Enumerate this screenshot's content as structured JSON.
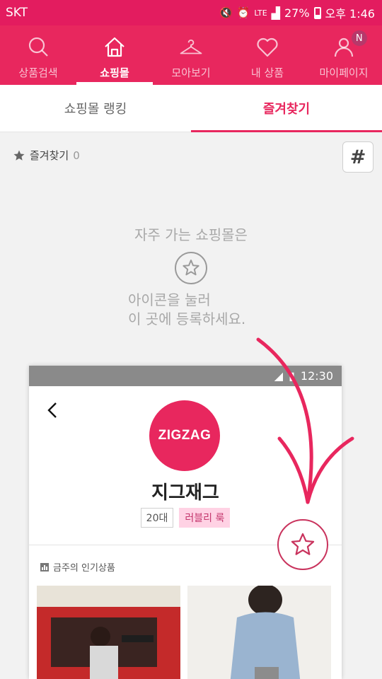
{
  "status_bar": {
    "carrier": "SKT",
    "network": "LTE",
    "battery": "27%",
    "time": "오후 1:46"
  },
  "nav": {
    "items": [
      {
        "label": "상품검색",
        "icon": "search-icon"
      },
      {
        "label": "쇼핑몰",
        "icon": "store-icon"
      },
      {
        "label": "모아보기",
        "icon": "hanger-icon"
      },
      {
        "label": "내 상품",
        "icon": "heart-icon"
      },
      {
        "label": "마이페이지",
        "icon": "person-icon"
      }
    ],
    "active_index": 1,
    "mypage_badge": "N"
  },
  "sub_tabs": {
    "ranking": "쇼핑몰 랭킹",
    "favorites": "즐겨찾기",
    "active": "favorites"
  },
  "favorites_bar": {
    "label": "즐겨찾기",
    "count": "0",
    "hash_button": "#"
  },
  "guide": {
    "line1": "자주 가는 쇼핑몰은",
    "line2": "아이콘을 눌러",
    "line3": "이 곳에 등록하세요."
  },
  "example_phone": {
    "time": "12:30",
    "logo_text": "ZIGZAG",
    "shop_name": "지그재그",
    "tags": [
      "20대",
      "러블리 룩"
    ],
    "popular_label": "금주의 인기상품"
  },
  "colors": {
    "brand": "#e8275e",
    "status_bar": "#e31c5f",
    "tag_pink_bg": "#ffd2e4"
  }
}
